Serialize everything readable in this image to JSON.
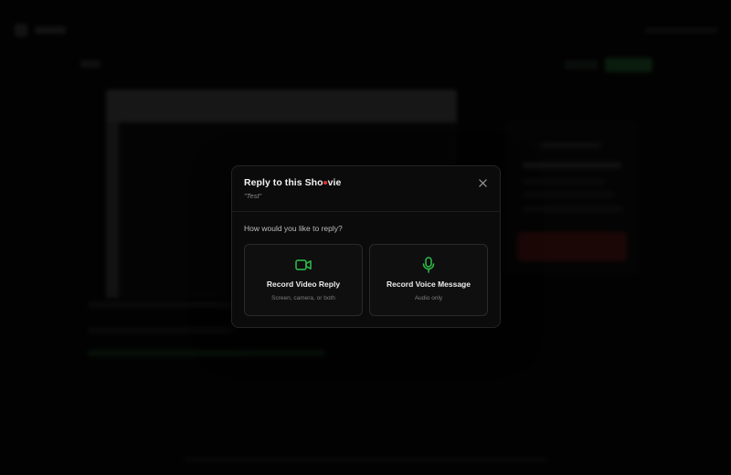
{
  "modal": {
    "title_prefix": "Reply to this Sho",
    "title_suffix": "vie",
    "subtitle": "\"Test\"",
    "question": "How would you like to reply?",
    "options": [
      {
        "title": "Record Video Reply",
        "description": "Screen, camera, or both",
        "icon": "video-camera-icon"
      },
      {
        "title": "Record Voice Message",
        "description": "Audio only",
        "icon": "microphone-icon"
      }
    ],
    "close_icon": "close-icon"
  },
  "colors": {
    "accent_green": "#2fbf4a",
    "record_red": "#e0342b",
    "modal_bg": "#0b0b0c",
    "page_bg": "#050505"
  }
}
